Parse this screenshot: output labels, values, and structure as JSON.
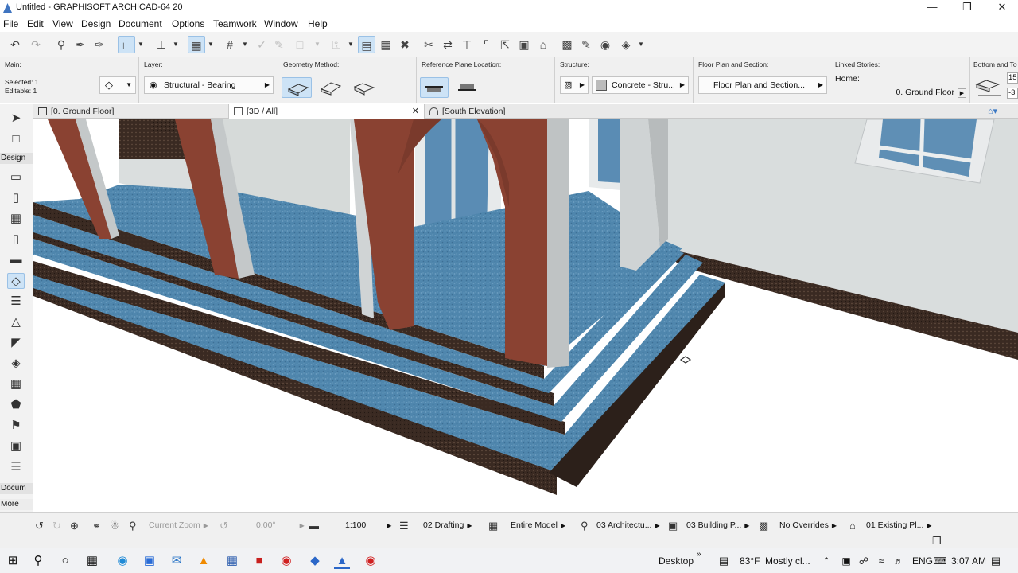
{
  "window": {
    "title": "Untitled - GRAPHISOFT ARCHICAD-64 20"
  },
  "menu": [
    "File",
    "Edit",
    "View",
    "Design",
    "Document",
    "Options",
    "Teamwork",
    "Window",
    "Help"
  ],
  "infobox": {
    "main_label": "Main:",
    "selected": "Selected: 1",
    "editable": "Editable: 1",
    "layer_label": "Layer:",
    "layer_value": "Structural - Bearing",
    "geometry_label": "Geometry Method:",
    "refplane_label": "Reference Plane Location:",
    "structure_label": "Structure:",
    "structure_value": "Concrete - Stru...",
    "floorplan_label": "Floor Plan and Section:",
    "floorplan_value": "Floor Plan and Section...",
    "linked_label": "Linked Stories:",
    "home_label": "Home:",
    "home_value": "0. Ground Floor",
    "bottom_label": "Bottom and To",
    "bottom_v1": "15",
    "bottom_v2": "-3"
  },
  "tabs": [
    {
      "label": "[0. Ground Floor]"
    },
    {
      "label": "[3D / All]"
    },
    {
      "label": "[South Elevation]"
    }
  ],
  "toolbox": {
    "design_label": "Design",
    "document_label": "Docum",
    "more_label": "More"
  },
  "statusbar": {
    "zoom": "Current Zoom",
    "angle": "0.00°",
    "scale": "1:100",
    "layer_combo": "02 Drafting",
    "model_view": "Entire Model",
    "pen_set": "03 Architectu...",
    "mvo": "03 Building P...",
    "overrides": "No Overrides",
    "renovation": "01 Existing Pl..."
  },
  "taskbar": {
    "desktop": "Desktop",
    "weather_temp": "83°F",
    "weather_text": "Mostly cl...",
    "lang": "ENG",
    "time": "3:07 AM"
  },
  "colors": {
    "stone_blue": "#4f86ad",
    "granite": "#3a2a22",
    "column": "#8a4232",
    "wall": "#d8dcdc",
    "selection": "#cde3f6"
  }
}
